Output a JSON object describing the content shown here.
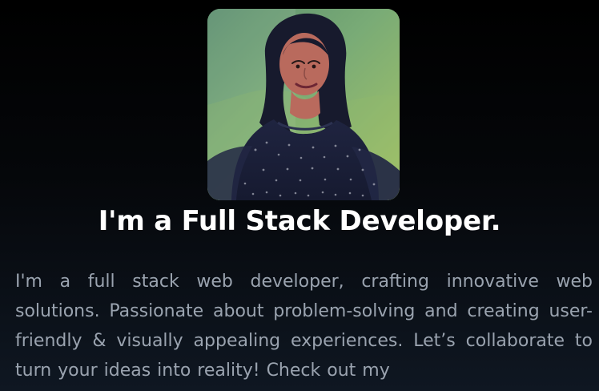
{
  "profile": {
    "image_alt": "Profile photo of developer",
    "heading": "I'm a Full Stack Developer.",
    "bio": "I'm a full stack web developer, crafting innovative web solutions. Passionate about problem-solving and creating user-friendly & visually appealing experiences. Let’s collaborate to turn your ideas into reality! Check out my"
  },
  "colors": {
    "background_top": "#000000",
    "background_bottom": "#0f1722",
    "heading": "#ffffff",
    "body_text": "#9aa3af",
    "photo_backdrop": "#79ab76"
  }
}
